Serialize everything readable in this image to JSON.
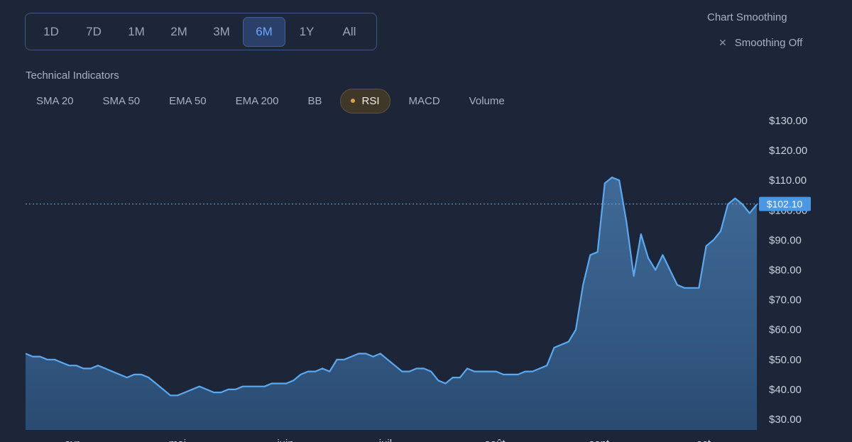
{
  "time_ranges": [
    {
      "label": "1D",
      "active": false
    },
    {
      "label": "7D",
      "active": false
    },
    {
      "label": "1M",
      "active": false
    },
    {
      "label": "2M",
      "active": false
    },
    {
      "label": "3M",
      "active": false
    },
    {
      "label": "6M",
      "active": true
    },
    {
      "label": "1Y",
      "active": false
    },
    {
      "label": "All",
      "active": false
    }
  ],
  "smoothing": {
    "title": "Chart Smoothing",
    "toggle_label": "Smoothing Off",
    "icon": "x-icon"
  },
  "indicators": {
    "title": "Technical Indicators",
    "items": [
      {
        "label": "SMA 20",
        "active": false
      },
      {
        "label": "SMA 50",
        "active": false
      },
      {
        "label": "EMA 50",
        "active": false
      },
      {
        "label": "EMA 200",
        "active": false
      },
      {
        "label": "BB",
        "active": false
      },
      {
        "label": "RSI",
        "active": true
      },
      {
        "label": "MACD",
        "active": false
      },
      {
        "label": "Volume",
        "active": false
      }
    ]
  },
  "colors": {
    "background": "#1d2638",
    "line": "#5aa9f0",
    "price_label_bg": "#4a97e6",
    "indicator_dot": "#d9a441"
  },
  "chart_data": {
    "type": "area",
    "title": "",
    "xlabel": "",
    "ylabel": "",
    "ylim": [
      30,
      130
    ],
    "y_ticks": [
      130,
      120,
      110,
      100,
      90,
      80,
      70,
      60,
      50,
      40,
      30
    ],
    "y_tick_labels": [
      "$130.00",
      "$120.00",
      "$110.00",
      "$100.00",
      "$90.00",
      "$80.00",
      "$70.00",
      "$60.00",
      "$50.00",
      "$40.00",
      "$30.00"
    ],
    "x_tick_labels": [
      "avr.",
      "mai",
      "juin",
      "juil.",
      "août",
      "sept.",
      "oct."
    ],
    "current_price": 102.1,
    "current_price_label": "$102.10",
    "grid": false,
    "series": [
      {
        "values": [
          52,
          51,
          51,
          50,
          50,
          49,
          48,
          48,
          47,
          47,
          48,
          47,
          46,
          45,
          44,
          45,
          45,
          44,
          42,
          40,
          38,
          38,
          39,
          40,
          41,
          40,
          39,
          39,
          40,
          40,
          41,
          41,
          41,
          41,
          42,
          42,
          42,
          43,
          45,
          46,
          46,
          47,
          46,
          50,
          50,
          51,
          52,
          52,
          51,
          52,
          50,
          48,
          46,
          46,
          47,
          47,
          46,
          43,
          42,
          44,
          44,
          47,
          46,
          46,
          46,
          46,
          45,
          45,
          45,
          46,
          46,
          47,
          48,
          54,
          55,
          56,
          60,
          75,
          85,
          86,
          109,
          111,
          110,
          96,
          78,
          92,
          84,
          80,
          85,
          80,
          75,
          74,
          74,
          74,
          88,
          90,
          93,
          102,
          104,
          102,
          99,
          102
        ]
      }
    ]
  }
}
